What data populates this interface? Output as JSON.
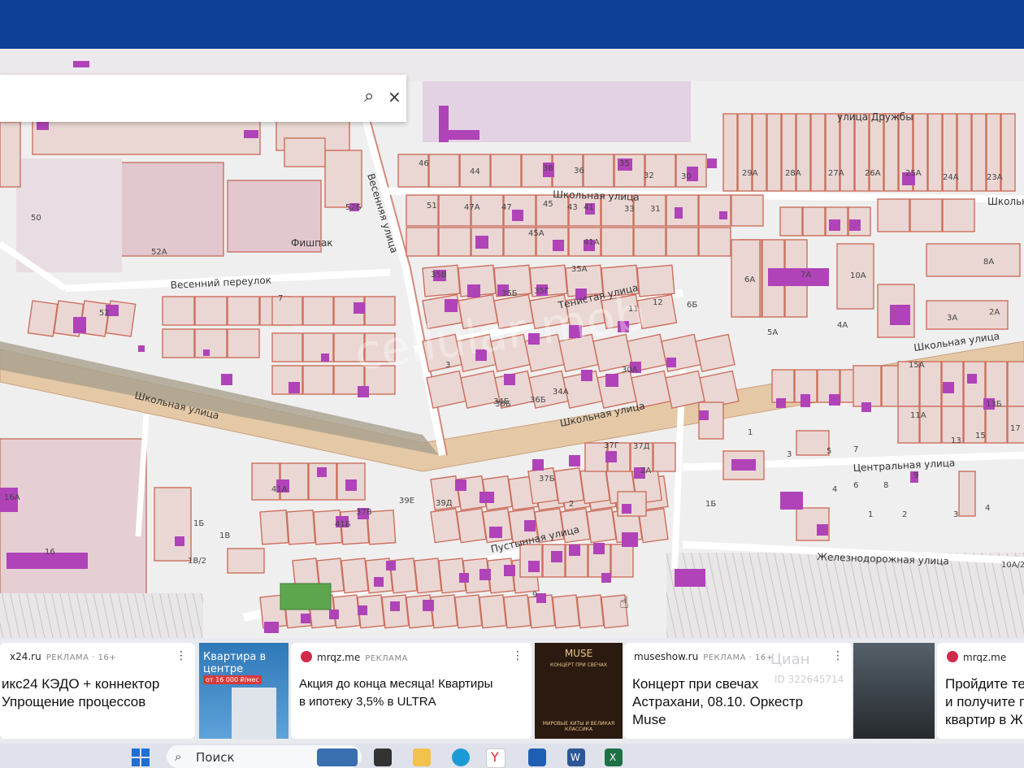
{
  "search": {
    "search_icon": "search-icon",
    "close_icon": "close-icon",
    "close_glyph": "×"
  },
  "map": {
    "watermark": "cellular mob",
    "streets": {
      "druzhby": "улица Дружбы",
      "shkolnaya_top": "Школьная улица",
      "shkolnaya_top_right": "Школьн",
      "vesennyaya": "Весенняя улица",
      "vesenniy_per": "Весенний переулок",
      "tenistaya": "Тенистая улица",
      "shkolnaya_main_left": "Школьная улица",
      "shkolnaya_main_mid": "Школьная улица",
      "shkolnaya_main_right": "Школьная улица",
      "tsentralnaya": "Центральная улица",
      "pustynnaya": "Пустынная улица",
      "zheleznodorozhnaya": "Железнодорожная улица"
    },
    "place_fishpak": "Фишпак",
    "numbers": {
      "n46": "46",
      "n44": "44",
      "n38": "38",
      "n36": "36",
      "n35": "35",
      "n32": "32",
      "n30": "30",
      "n29a": "29А",
      "n28a": "28А",
      "n27a": "27А",
      "n26a": "26А",
      "n25a": "25А",
      "n24a": "24А",
      "n23a": "23А",
      "n51": "51",
      "n47a": "47А",
      "n47": "47",
      "n45": "45",
      "n43": "43",
      "n41": "41",
      "n33": "33",
      "n31": "31",
      "n45a": "45А",
      "n41a": "41А",
      "n50": "50",
      "n52a": "52А",
      "n52b": "52Б",
      "n35a": "35А",
      "n35v": "35В",
      "n35b": "35Б",
      "n35g": "35Г",
      "n12": "12",
      "n11": "11",
      "n6b": "6Б",
      "n6a": "6А",
      "n7a": "7А",
      "n10a": "10А",
      "n8a": "8А",
      "n3a": "3А",
      "n2a": "2А",
      "n4a": "4А",
      "n5a": "5А",
      "n52": "52",
      "n7": "7",
      "n3": "3",
      "n34b": "34Б",
      "n34a": "34А",
      "n30a": "30А",
      "n38b": "38Б",
      "n36b": "36Б",
      "n15a": "15А",
      "n13b": "13Б",
      "n11a": "11А",
      "n17": "17",
      "n13": "13",
      "n15": "15",
      "n1": "1",
      "n5": "5",
      "n3s": "3",
      "n7s": "7",
      "n9": "9",
      "n37g": "37Г",
      "n37d": "37Д",
      "n2a_s": "2А",
      "n37b": "37Б",
      "n39e": "39Е",
      "n39d": "39Д",
      "n2": "2",
      "n41b": "41Б",
      "n37v": "37В",
      "n41a_s": "41А",
      "n16": "16",
      "n1b": "1Б",
      "n1v": "1В",
      "n1v2": "1В/2",
      "n16a": "16А",
      "n16b": "1Б",
      "n4": "4",
      "n6": "6",
      "n8": "8",
      "n1e": "1",
      "n2e": "2",
      "n3e": "3",
      "n4e": "4",
      "n10a2": "10А/2",
      "n9s": "9"
    }
  },
  "ads": [
    {
      "source": "x24.ru",
      "mark": "РЕКЛАМА · 16+",
      "title": "икс24 КЭДО + коннектор",
      "title2": "Упрощение процессов"
    },
    {
      "banner_title": "Квартира в центре",
      "banner_price": "от 16 000 ₽/мес"
    },
    {
      "source": "mrqz.me",
      "mark": "РЕКЛАМА",
      "title": "Акция до конца месяца! Квартиры",
      "title2": "в ипотеку 3,5% в ULTRA"
    },
    {
      "banner_brand": "MUSE",
      "banner_text": "КОНЦЕРТ ПРИ СВЕЧАХ",
      "banner_sub": "МИРОВЫЕ ХИТЫ И ВЕЛИКАЯ КЛАССИКА"
    },
    {
      "source": "museshow.ru",
      "mark": "РЕКЛАМА · 16+",
      "title": "Концерт при свечах",
      "title2": "Астрахани, 08.10. Оркестр",
      "title3": "Muse"
    },
    {
      "source": "mrqz.me",
      "mark": "РЕКЛАМА",
      "title": "Пройдите те",
      "title2": "и получите п",
      "title3": "квартир в Ж"
    }
  ],
  "ad_watermark": "Циан",
  "ad_watermark_id": "ID 322645714",
  "taskbar": {
    "search_label": "Поиск"
  }
}
